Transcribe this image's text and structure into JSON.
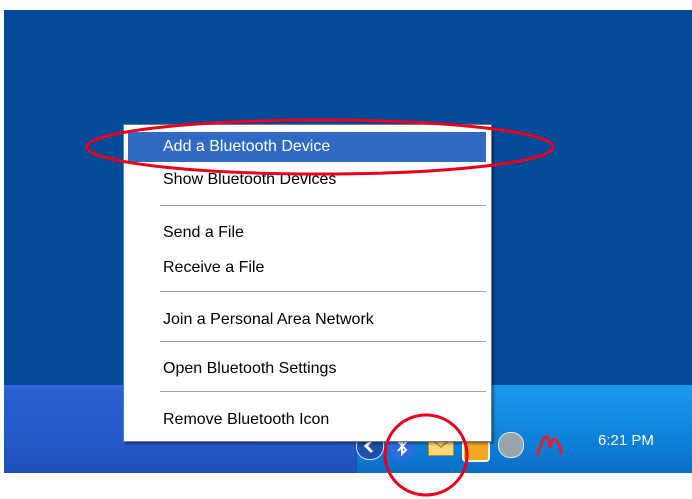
{
  "menu": {
    "groups": [
      {
        "items": [
          {
            "label": "Add a Bluetooth Device",
            "selected": true
          },
          {
            "label": "Show Bluetooth Devices"
          }
        ]
      },
      {
        "items": [
          {
            "label": "Send a File"
          },
          {
            "label": "Receive a File"
          }
        ]
      },
      {
        "items": [
          {
            "label": "Join a Personal Area Network"
          }
        ]
      },
      {
        "items": [
          {
            "label": "Open Bluetooth Settings"
          }
        ]
      },
      {
        "items": [
          {
            "label": "Remove Bluetooth Icon"
          }
        ]
      }
    ]
  },
  "taskbar": {
    "tray_icons": [
      "tray-expand-icon",
      "bluetooth-icon",
      "envelope-icon",
      "shield-icon",
      "speaker-icon",
      "acrobat-icon"
    ],
    "clock": "6:21 PM"
  },
  "colors": {
    "desktop": "#024b9a",
    "menu_highlight": "#316ac5",
    "annotation": "#e8001c"
  }
}
